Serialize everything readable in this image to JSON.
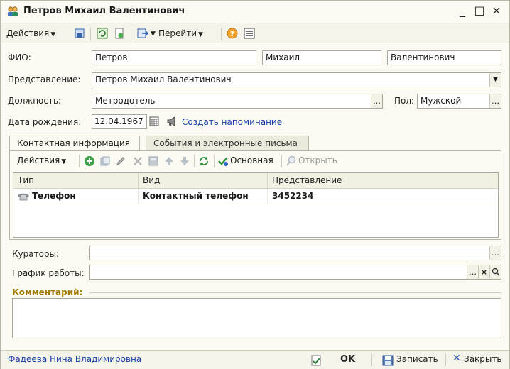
{
  "window": {
    "title": "Петров Михаил Валентинович",
    "minimize": "_",
    "maximize": "□",
    "close": "×"
  },
  "toolbar": {
    "actions_label": "Действия",
    "goto_label": "Перейти"
  },
  "form": {
    "fio_label": "ФИО:",
    "last_name": "Петров",
    "first_name": "Михаил",
    "middle_name": "Валентинович",
    "representation_label": "Представление:",
    "representation_value": "Петров Михаил Валентинович",
    "position_label": "Должность:",
    "position_value": "Метродотель",
    "gender_label": "Пол:",
    "gender_value": "Мужской",
    "birth_label": "Дата рождения:",
    "birth_value": "12.04.1967",
    "reminder_link": "Создать напоминание",
    "curators_label": "Кураторы:",
    "schedule_label": "График работы:",
    "comment_label": "Комментарий:"
  },
  "tabs": [
    {
      "label": "Контактная информация",
      "active": true
    },
    {
      "label": "События и электронные письма",
      "active": false
    }
  ],
  "contacts_toolbar": {
    "actions_label": "Действия",
    "primary_label": "Основная",
    "open_label": "Открыть"
  },
  "contacts_table": {
    "columns": [
      "Тип",
      "Вид",
      "Представление"
    ],
    "rows": [
      {
        "type": "Телефон",
        "kind": "Контактный телефон",
        "value": "3452234"
      }
    ]
  },
  "footer": {
    "responsible": "Фадеева Нина Владимировна",
    "ok_label": "OK",
    "save_label": "Записать",
    "close_label": "Закрыть"
  },
  "colors": {
    "background": "#fbfbf4",
    "link": "#1b3ea8",
    "comment_heading": "#a07a00"
  }
}
